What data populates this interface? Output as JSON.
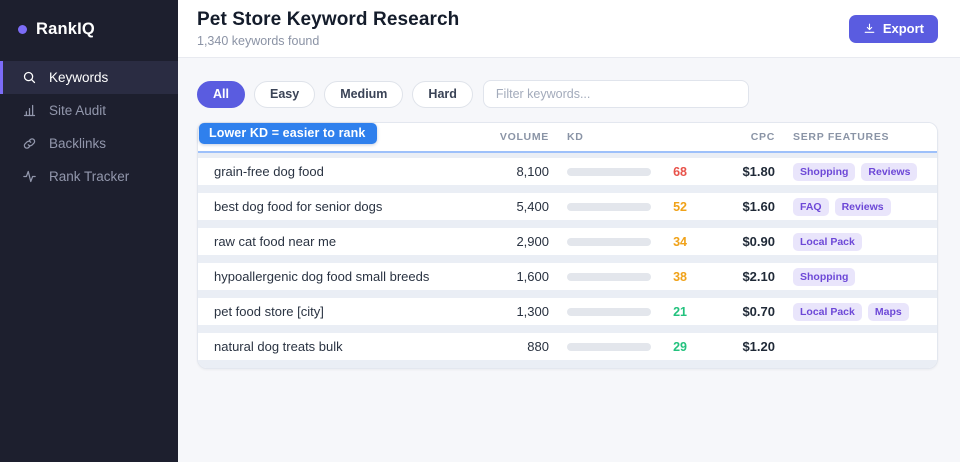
{
  "brand": {
    "name": "RankIQ"
  },
  "sidebar": {
    "items": [
      {
        "label": "Keywords",
        "icon": "search-icon",
        "active": true
      },
      {
        "label": "Site Audit",
        "icon": "bar-chart-icon",
        "active": false
      },
      {
        "label": "Backlinks",
        "icon": "link-icon",
        "active": false
      },
      {
        "label": "Rank Tracker",
        "icon": "activity-icon",
        "active": false
      }
    ]
  },
  "header": {
    "title": "Pet Store Keyword Research",
    "subtitle": "1,340 keywords found",
    "export_label": "Export"
  },
  "filters": {
    "chips": [
      "All",
      "Easy",
      "Medium",
      "Hard"
    ],
    "active_chip": "All",
    "search_placeholder": "Filter keywords..."
  },
  "tooltip_text": "Lower KD = easier to rank",
  "table": {
    "columns": [
      "VOLUME",
      "KD",
      "CPC",
      "SERP FEATURES"
    ],
    "rows": [
      {
        "keyword": "grain-free dog food",
        "volume": "8,100",
        "kd": 68,
        "kd_level": "hard",
        "cpc": "$1.80",
        "serp": [
          "Shopping",
          "Reviews"
        ]
      },
      {
        "keyword": "best dog food for senior dogs",
        "volume": "5,400",
        "kd": 52,
        "kd_level": "medium",
        "cpc": "$1.60",
        "serp": [
          "FAQ",
          "Reviews"
        ]
      },
      {
        "keyword": "raw cat food near me",
        "volume": "2,900",
        "kd": 34,
        "kd_level": "medium",
        "cpc": "$0.90",
        "serp": [
          "Local Pack"
        ]
      },
      {
        "keyword": "hypoallergenic dog food small breeds",
        "volume": "1,600",
        "kd": 38,
        "kd_level": "medium",
        "cpc": "$2.10",
        "serp": [
          "Shopping"
        ]
      },
      {
        "keyword": "pet food store [city]",
        "volume": "1,300",
        "kd": 21,
        "kd_level": "easy",
        "cpc": "$0.70",
        "serp": [
          "Local Pack",
          "Maps"
        ]
      },
      {
        "keyword": "natural dog treats bulk",
        "volume": "880",
        "kd": 29,
        "kd_level": "easy",
        "cpc": "$1.20",
        "serp": []
      }
    ]
  },
  "colors": {
    "accent_purple": "#5a5ce0",
    "brand_dot": "#7c6cf7",
    "tooltip_blue": "#2f80ed",
    "kd": {
      "hard": "#e8524a",
      "medium": "#f0a219",
      "easy": "#23c27e"
    },
    "badge_bg": "#e9e5fb",
    "badge_text": "#6d48d7"
  }
}
